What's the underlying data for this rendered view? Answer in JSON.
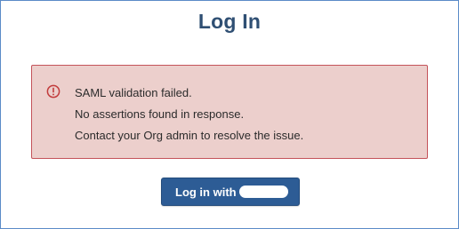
{
  "page": {
    "title": "Log In"
  },
  "alert": {
    "icon": "alert-circle-icon",
    "lines": [
      "SAML validation failed.",
      "No assertions found in response.",
      "Contact your Org admin to resolve the issue."
    ],
    "colors": {
      "background": "#eccfcc",
      "border": "#c4535a",
      "icon": "#c23b3b"
    }
  },
  "login_button": {
    "label": "Log in with",
    "color": "#2d5c95"
  },
  "colors": {
    "title": "#2f4f73",
    "frame_border": "#5b8bc8"
  }
}
